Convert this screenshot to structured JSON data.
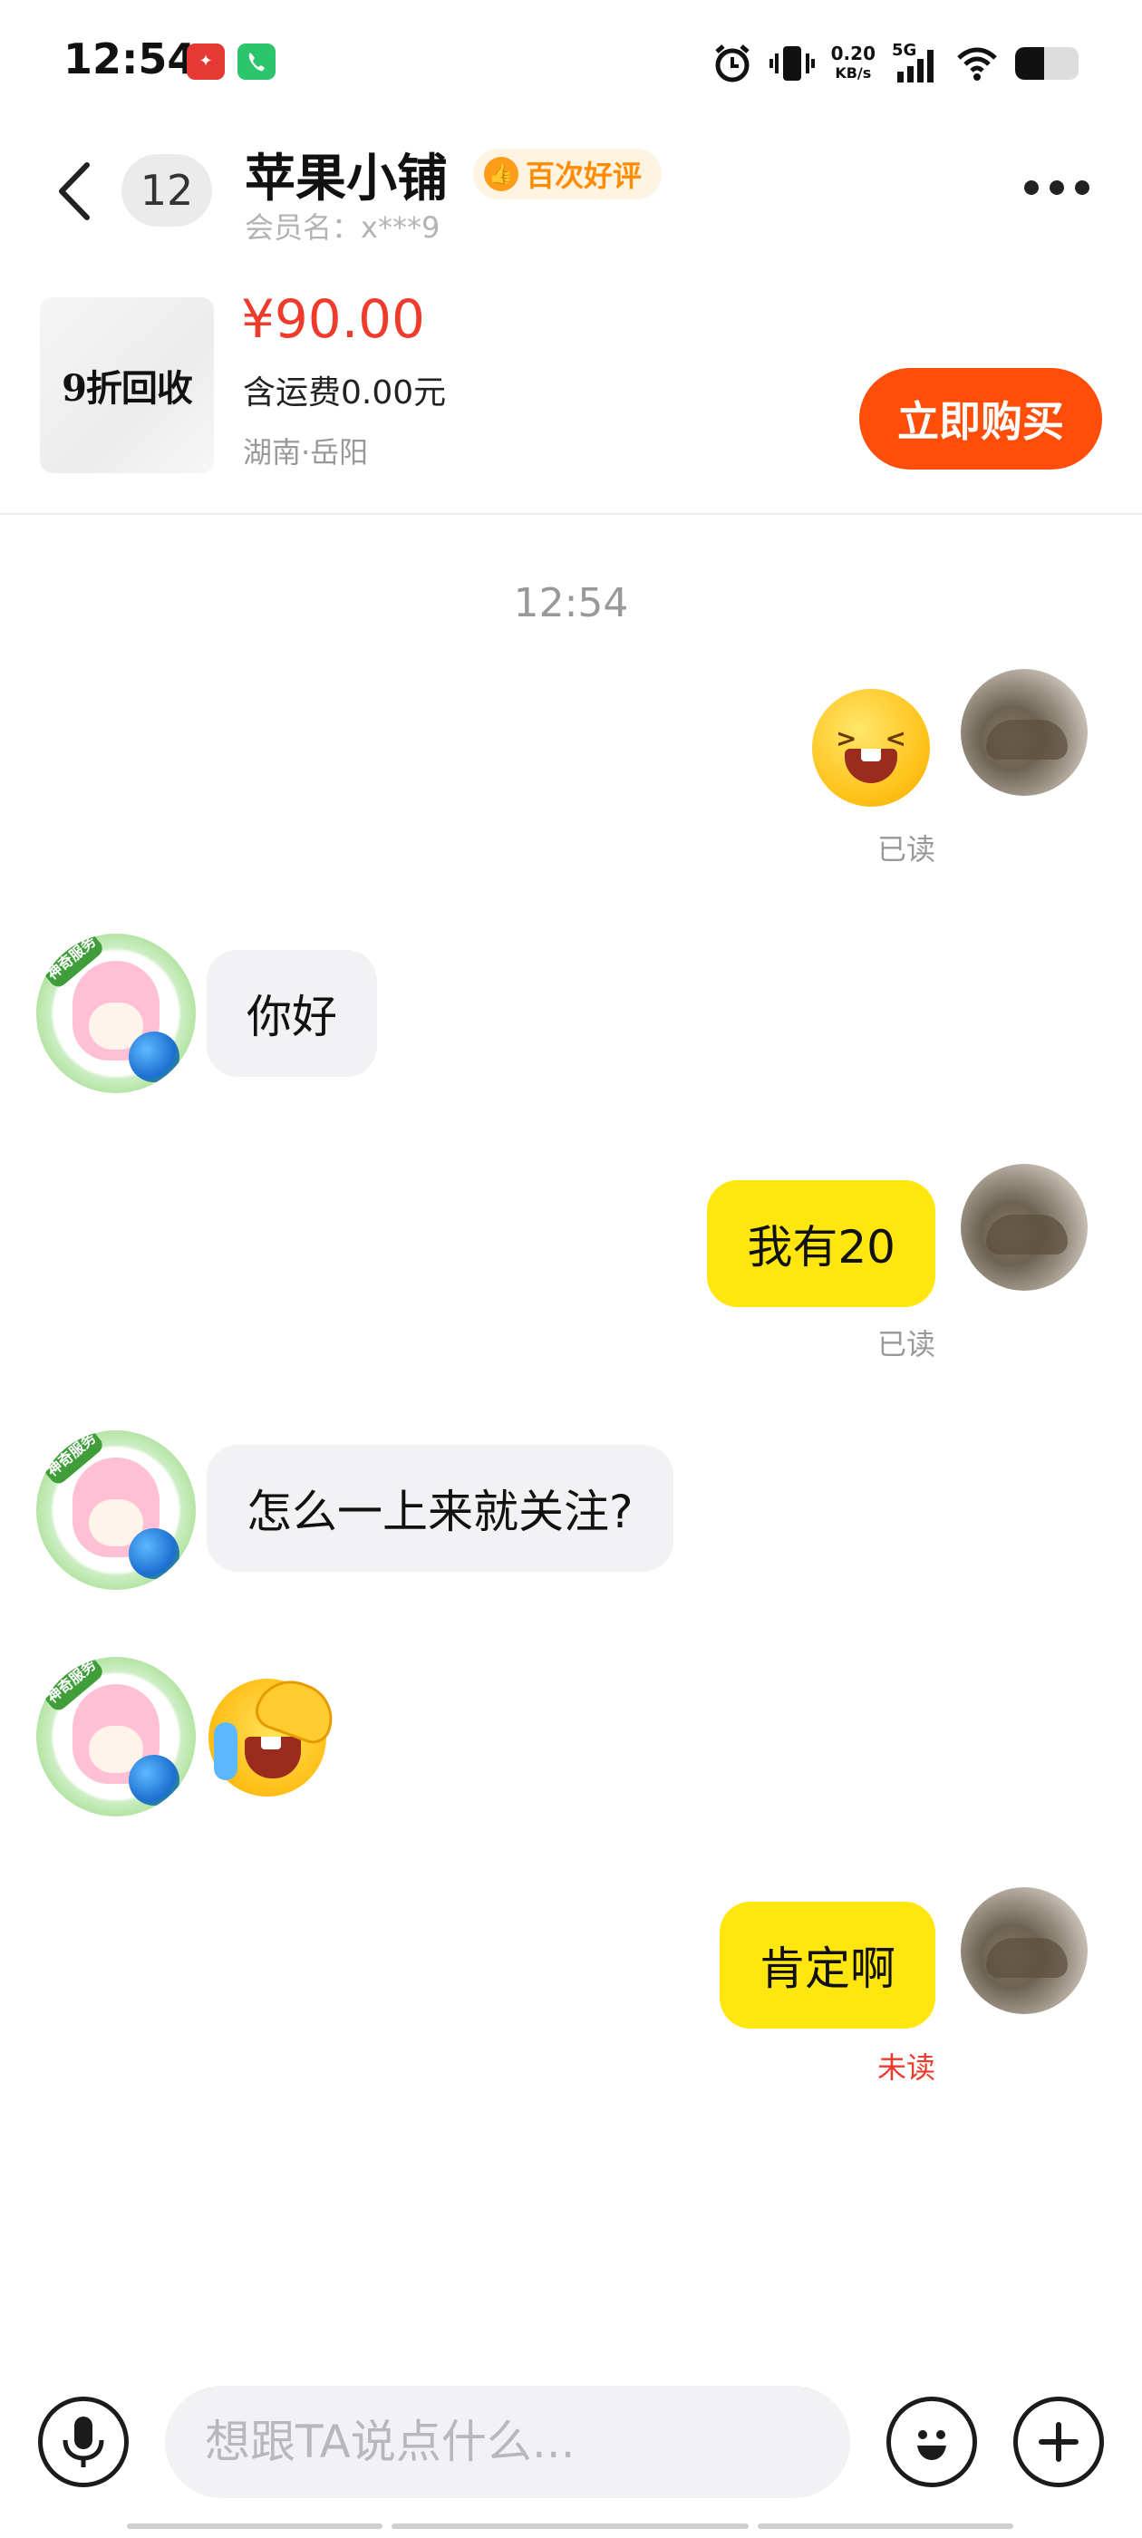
{
  "status_bar": {
    "time": "12:54",
    "net_speed_value": "0.20",
    "net_speed_unit": "KB/s",
    "signal": "5G",
    "app_icons": [
      "red-app-icon",
      "phone-app-icon"
    ],
    "right_icons": [
      "alarm-icon",
      "vibrate-icon",
      "signal-icon",
      "wifi-icon",
      "battery-icon"
    ]
  },
  "header": {
    "unread_count": "12",
    "shop_name": "苹果小铺",
    "rating_badge": "百次好评",
    "member_label": "会员名：x***9"
  },
  "product": {
    "thumb_text": "9折回收",
    "price": "¥90.00",
    "shipping": "含运费0.00元",
    "location": "湖南·岳阳",
    "buy_label": "立即购买"
  },
  "chat": {
    "time_separator": "12:54",
    "messages": [
      {
        "from": "me",
        "type": "emoji",
        "emoji": "laughing-emoji",
        "status": "已读"
      },
      {
        "from": "seller",
        "type": "text",
        "text": "你好"
      },
      {
        "from": "me",
        "type": "text",
        "text": "我有20",
        "status": "已读"
      },
      {
        "from": "seller",
        "type": "text",
        "text": "怎么一上来就关注?"
      },
      {
        "from": "seller",
        "type": "emoji",
        "emoji": "crying-laughing-emoji"
      },
      {
        "from": "me",
        "type": "text",
        "text": "肯定啊",
        "status": "未读"
      }
    ],
    "seller_avatar_badge": "神奇服务"
  },
  "input_bar": {
    "placeholder": "想跟TA说点什么..."
  },
  "colors": {
    "accent_orange": "#ff4d0a",
    "price_red": "#ee3b2b",
    "bubble_yellow": "#ffe60f",
    "bubble_gray": "#f2f2f4",
    "unread_red": "#ee3b2b"
  }
}
